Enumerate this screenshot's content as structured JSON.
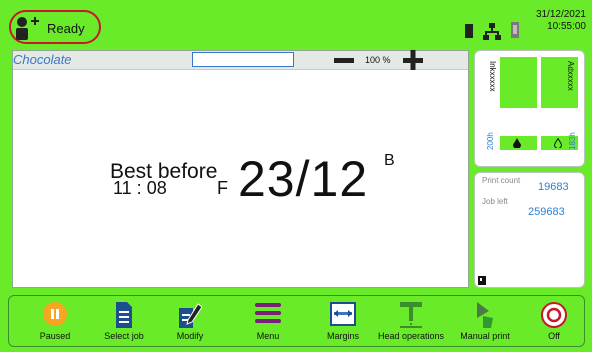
{
  "status": {
    "text": "Ready"
  },
  "datetime": {
    "date": "31/12/2021",
    "time": "10:55:00"
  },
  "job": {
    "name": "Chocolate",
    "input_value": ""
  },
  "zoom": {
    "label": "100 %"
  },
  "message": {
    "line1": "Best before",
    "line2": "11 : 08",
    "letter_f": "F",
    "big": "23/12",
    "letter_b": "B"
  },
  "ink": {
    "left_label": "Inkxxxxx",
    "left_hours": "200h",
    "right_label": "Adxxxxx",
    "right_hours": "183h"
  },
  "counts": {
    "print_count_label": "Print count",
    "print_count_value": "19683",
    "job_left_label": "Job left",
    "job_left_value": "259683"
  },
  "toolbar": {
    "paused": "Paused",
    "select_job": "Select job",
    "modify": "Modify",
    "menu": "Menu",
    "margins": "Margins",
    "head_operations": "Head operations",
    "manual_print": "Manual print",
    "off": "Off"
  },
  "colors": {
    "background": "#6aeb2a",
    "accent_blue": "#3a77c9",
    "status_ring": "#c7182a",
    "pause_orange": "#f5a623",
    "menu_purple": "#7a1f7a"
  }
}
